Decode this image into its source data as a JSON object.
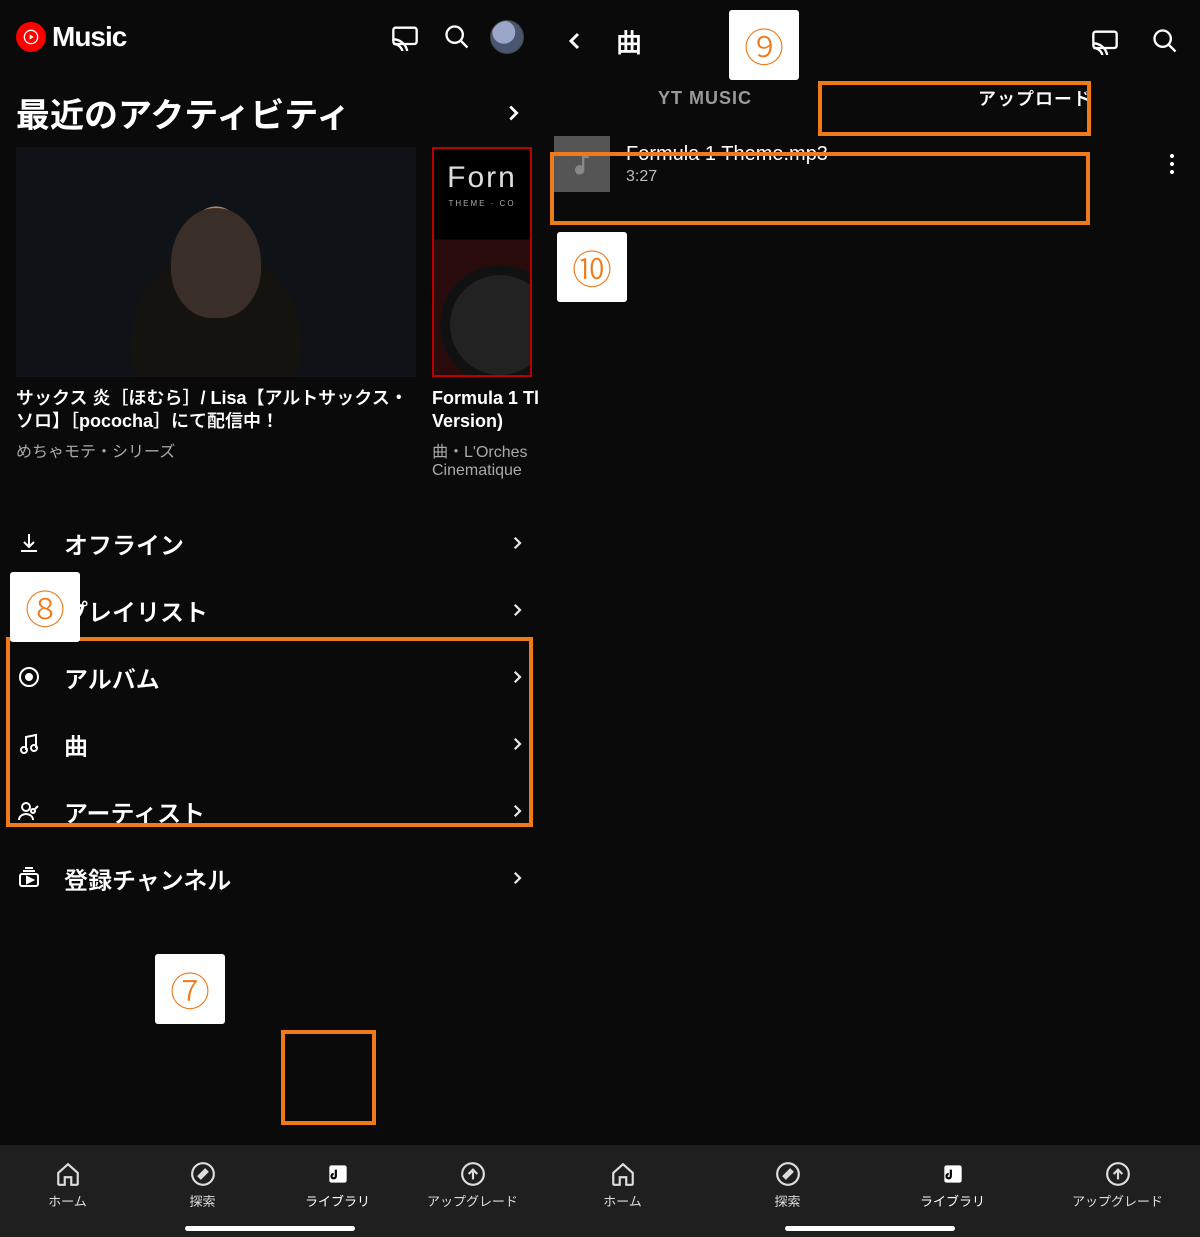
{
  "left": {
    "logo_text": "Music",
    "section_title": "最近のアクティビティ",
    "cards": [
      {
        "title": "サックス 炎［ほむら］/ Lisa【アルトサックス・ソロ】［pococha］にて配信中！",
        "subtitle": "めちゃモテ・シリーズ"
      },
      {
        "thumb_t1": "Forn",
        "thumb_t2": "THEME · CO",
        "title": "Formula 1 Tl",
        "title2": "Version)",
        "subtitle": "曲・L'Orches",
        "subtitle2": "Cinematique"
      }
    ],
    "menu": [
      {
        "icon": "download",
        "label": "オフライン"
      },
      {
        "icon": "playlist",
        "label": "プレイリスト"
      },
      {
        "icon": "disc",
        "label": "アルバム"
      },
      {
        "icon": "note",
        "label": "曲"
      },
      {
        "icon": "artist",
        "label": "アーティスト"
      },
      {
        "icon": "sub",
        "label": "登録チャンネル"
      }
    ],
    "bottomnav": [
      {
        "icon": "home",
        "label": "ホーム"
      },
      {
        "icon": "compass",
        "label": "探索"
      },
      {
        "icon": "library",
        "label": "ライブラリ",
        "active": true
      },
      {
        "icon": "upgrade",
        "label": "アップグレード"
      }
    ]
  },
  "right": {
    "header_title": "曲",
    "tabs": [
      {
        "label": "YT MUSIC"
      },
      {
        "label": "アップロード",
        "active": true
      }
    ],
    "track": {
      "title": "Formula 1 Theme.mp3",
      "duration": "3:27"
    },
    "bottomnav": [
      {
        "icon": "home",
        "label": "ホーム"
      },
      {
        "icon": "compass",
        "label": "探索"
      },
      {
        "icon": "library",
        "label": "ライブラリ",
        "active": true
      },
      {
        "icon": "upgrade",
        "label": "アップグレード"
      }
    ]
  },
  "annotations": {
    "b7": "⑦",
    "b8": "⑧",
    "b9": "⑨",
    "b10": "⑩"
  }
}
